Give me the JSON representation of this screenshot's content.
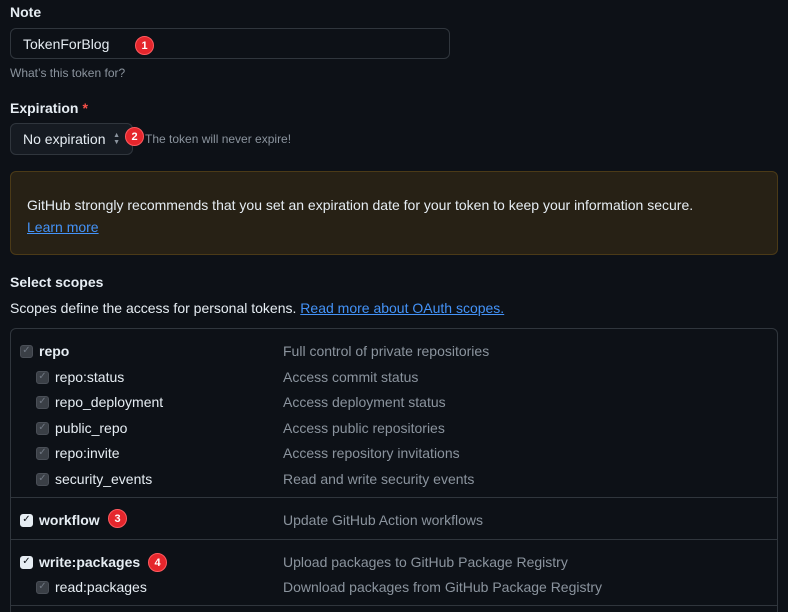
{
  "note": {
    "label": "Note",
    "value": "TokenForBlog",
    "helper": "What’s this token for?"
  },
  "expiration": {
    "label": "Expiration",
    "required_mark": "*",
    "selected": "No expiration",
    "helper": "The token will never expire!"
  },
  "warning": {
    "text": "GitHub strongly recommends that you set an expiration date for your token to keep your information secure.",
    "link": "Learn more"
  },
  "scopes": {
    "title": "Select scopes",
    "description": "Scopes define the access for personal tokens.",
    "link": "Read more about OAuth scopes.",
    "items": [
      {
        "name": "repo",
        "desc": "Full control of private repositories",
        "state": "disabled-checked"
      },
      {
        "name": "repo:status",
        "desc": "Access commit status",
        "state": "disabled-checked"
      },
      {
        "name": "repo_deployment",
        "desc": "Access deployment status",
        "state": "disabled-checked"
      },
      {
        "name": "public_repo",
        "desc": "Access public repositories",
        "state": "disabled-checked"
      },
      {
        "name": "repo:invite",
        "desc": "Access repository invitations",
        "state": "disabled-checked"
      },
      {
        "name": "security_events",
        "desc": "Read and write security events",
        "state": "disabled-checked"
      },
      {
        "name": "workflow",
        "desc": "Update GitHub Action workflows",
        "state": "checked"
      },
      {
        "name": "write:packages",
        "desc": "Upload packages to GitHub Package Registry",
        "state": "checked"
      },
      {
        "name": "read:packages",
        "desc": "Download packages from GitHub Package Registry",
        "state": "disabled-checked"
      }
    ]
  },
  "annotations": [
    "1",
    "2",
    "3",
    "4"
  ],
  "icons": {
    "checkmark": "check-icon",
    "select_arrows": "chevron-updown-icon"
  },
  "colors": {
    "background": "#0d1117",
    "annotation_badge": "#e5262c",
    "link": "#4493f8",
    "warning_bg": "#272115"
  }
}
